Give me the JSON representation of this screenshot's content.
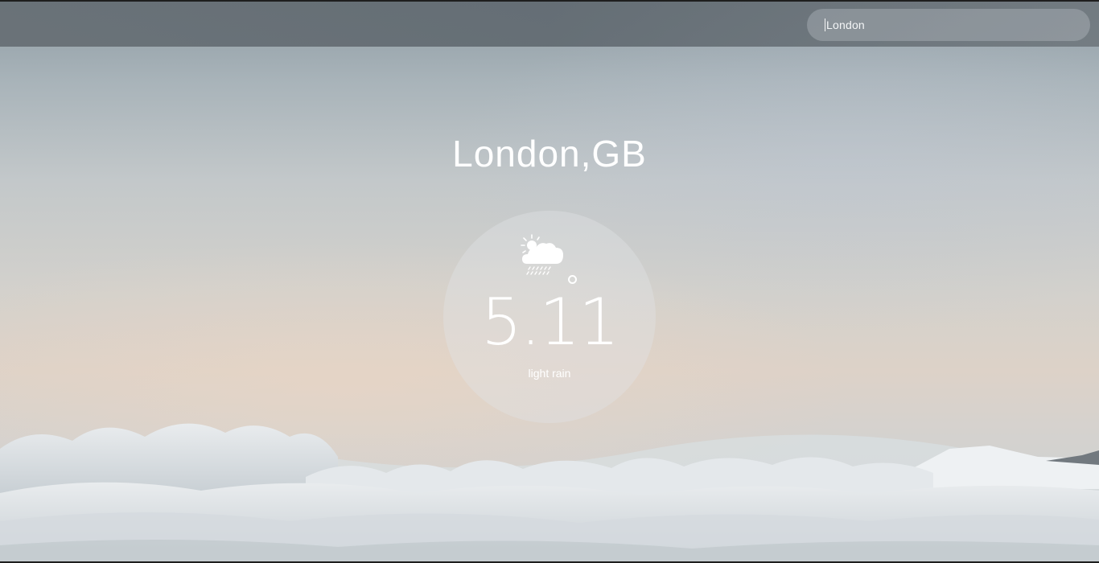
{
  "search": {
    "value": "London"
  },
  "location": {
    "city": "London,GB"
  },
  "weather": {
    "temperature": "5.11",
    "description": "light rain",
    "icon": "sun-cloud-rain-icon"
  }
}
